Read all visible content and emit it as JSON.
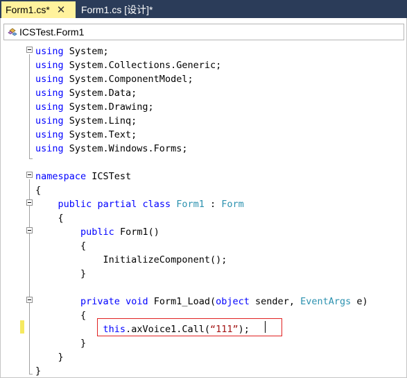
{
  "tabs": [
    {
      "label": "Form1.cs*",
      "close_symbol": "✕",
      "active": true
    },
    {
      "label": "Form1.cs [设计]*",
      "active": false
    }
  ],
  "navbar": {
    "class_dropdown": "ICSTest.Form1"
  },
  "code_lines": [
    [
      {
        "t": "using",
        "c": "kw"
      },
      {
        "t": " System;"
      }
    ],
    [
      {
        "t": "using",
        "c": "kw"
      },
      {
        "t": " System.Collections.Generic;"
      }
    ],
    [
      {
        "t": "using",
        "c": "kw"
      },
      {
        "t": " System.ComponentModel;"
      }
    ],
    [
      {
        "t": "using",
        "c": "kw"
      },
      {
        "t": " System.Data;"
      }
    ],
    [
      {
        "t": "using",
        "c": "kw"
      },
      {
        "t": " System.Drawing;"
      }
    ],
    [
      {
        "t": "using",
        "c": "kw"
      },
      {
        "t": " System.Linq;"
      }
    ],
    [
      {
        "t": "using",
        "c": "kw"
      },
      {
        "t": " System.Text;"
      }
    ],
    [
      {
        "t": "using",
        "c": "kw"
      },
      {
        "t": " System.Windows.Forms;"
      }
    ],
    [],
    [
      {
        "t": "namespace",
        "c": "kw"
      },
      {
        "t": " ICSTest"
      }
    ],
    [
      {
        "t": "{"
      }
    ],
    [
      {
        "t": "    "
      },
      {
        "t": "public",
        "c": "kw"
      },
      {
        "t": " "
      },
      {
        "t": "partial",
        "c": "kw"
      },
      {
        "t": " "
      },
      {
        "t": "class",
        "c": "kw"
      },
      {
        "t": " "
      },
      {
        "t": "Form1",
        "c": "type"
      },
      {
        "t": " : "
      },
      {
        "t": "Form",
        "c": "type"
      }
    ],
    [
      {
        "t": "    {"
      }
    ],
    [
      {
        "t": "        "
      },
      {
        "t": "public",
        "c": "kw"
      },
      {
        "t": " Form1()"
      }
    ],
    [
      {
        "t": "        {"
      }
    ],
    [
      {
        "t": "            InitializeComponent();"
      }
    ],
    [
      {
        "t": "        }"
      }
    ],
    [],
    [
      {
        "t": "        "
      },
      {
        "t": "private",
        "c": "kw"
      },
      {
        "t": " "
      },
      {
        "t": "void",
        "c": "kw"
      },
      {
        "t": " Form1_Load("
      },
      {
        "t": "object",
        "c": "kw"
      },
      {
        "t": " sender, "
      },
      {
        "t": "EventArgs",
        "c": "type"
      },
      {
        "t": " e)"
      }
    ],
    [
      {
        "t": "        {"
      }
    ],
    [
      {
        "t": "            "
      },
      {
        "t": "this",
        "c": "kw"
      },
      {
        "t": ".axVoice1.Call("
      },
      {
        "t": "“111”",
        "c": "str"
      },
      {
        "t": ");"
      }
    ],
    [
      {
        "t": "        }"
      }
    ],
    [
      {
        "t": "    }"
      }
    ],
    [
      {
        "t": "}"
      }
    ]
  ],
  "colors": {
    "tab_bar_bg": "#2b3c59",
    "active_tab_bg": "#fff29d",
    "keyword": "#0000ff",
    "type_name": "#2b91af",
    "string": "#a31515",
    "highlight_border": "#e02020",
    "change_marker": "#f5e960"
  },
  "icons": {
    "class_icon": "class-icon",
    "close": "close-icon",
    "fold": "collapse-icon"
  }
}
